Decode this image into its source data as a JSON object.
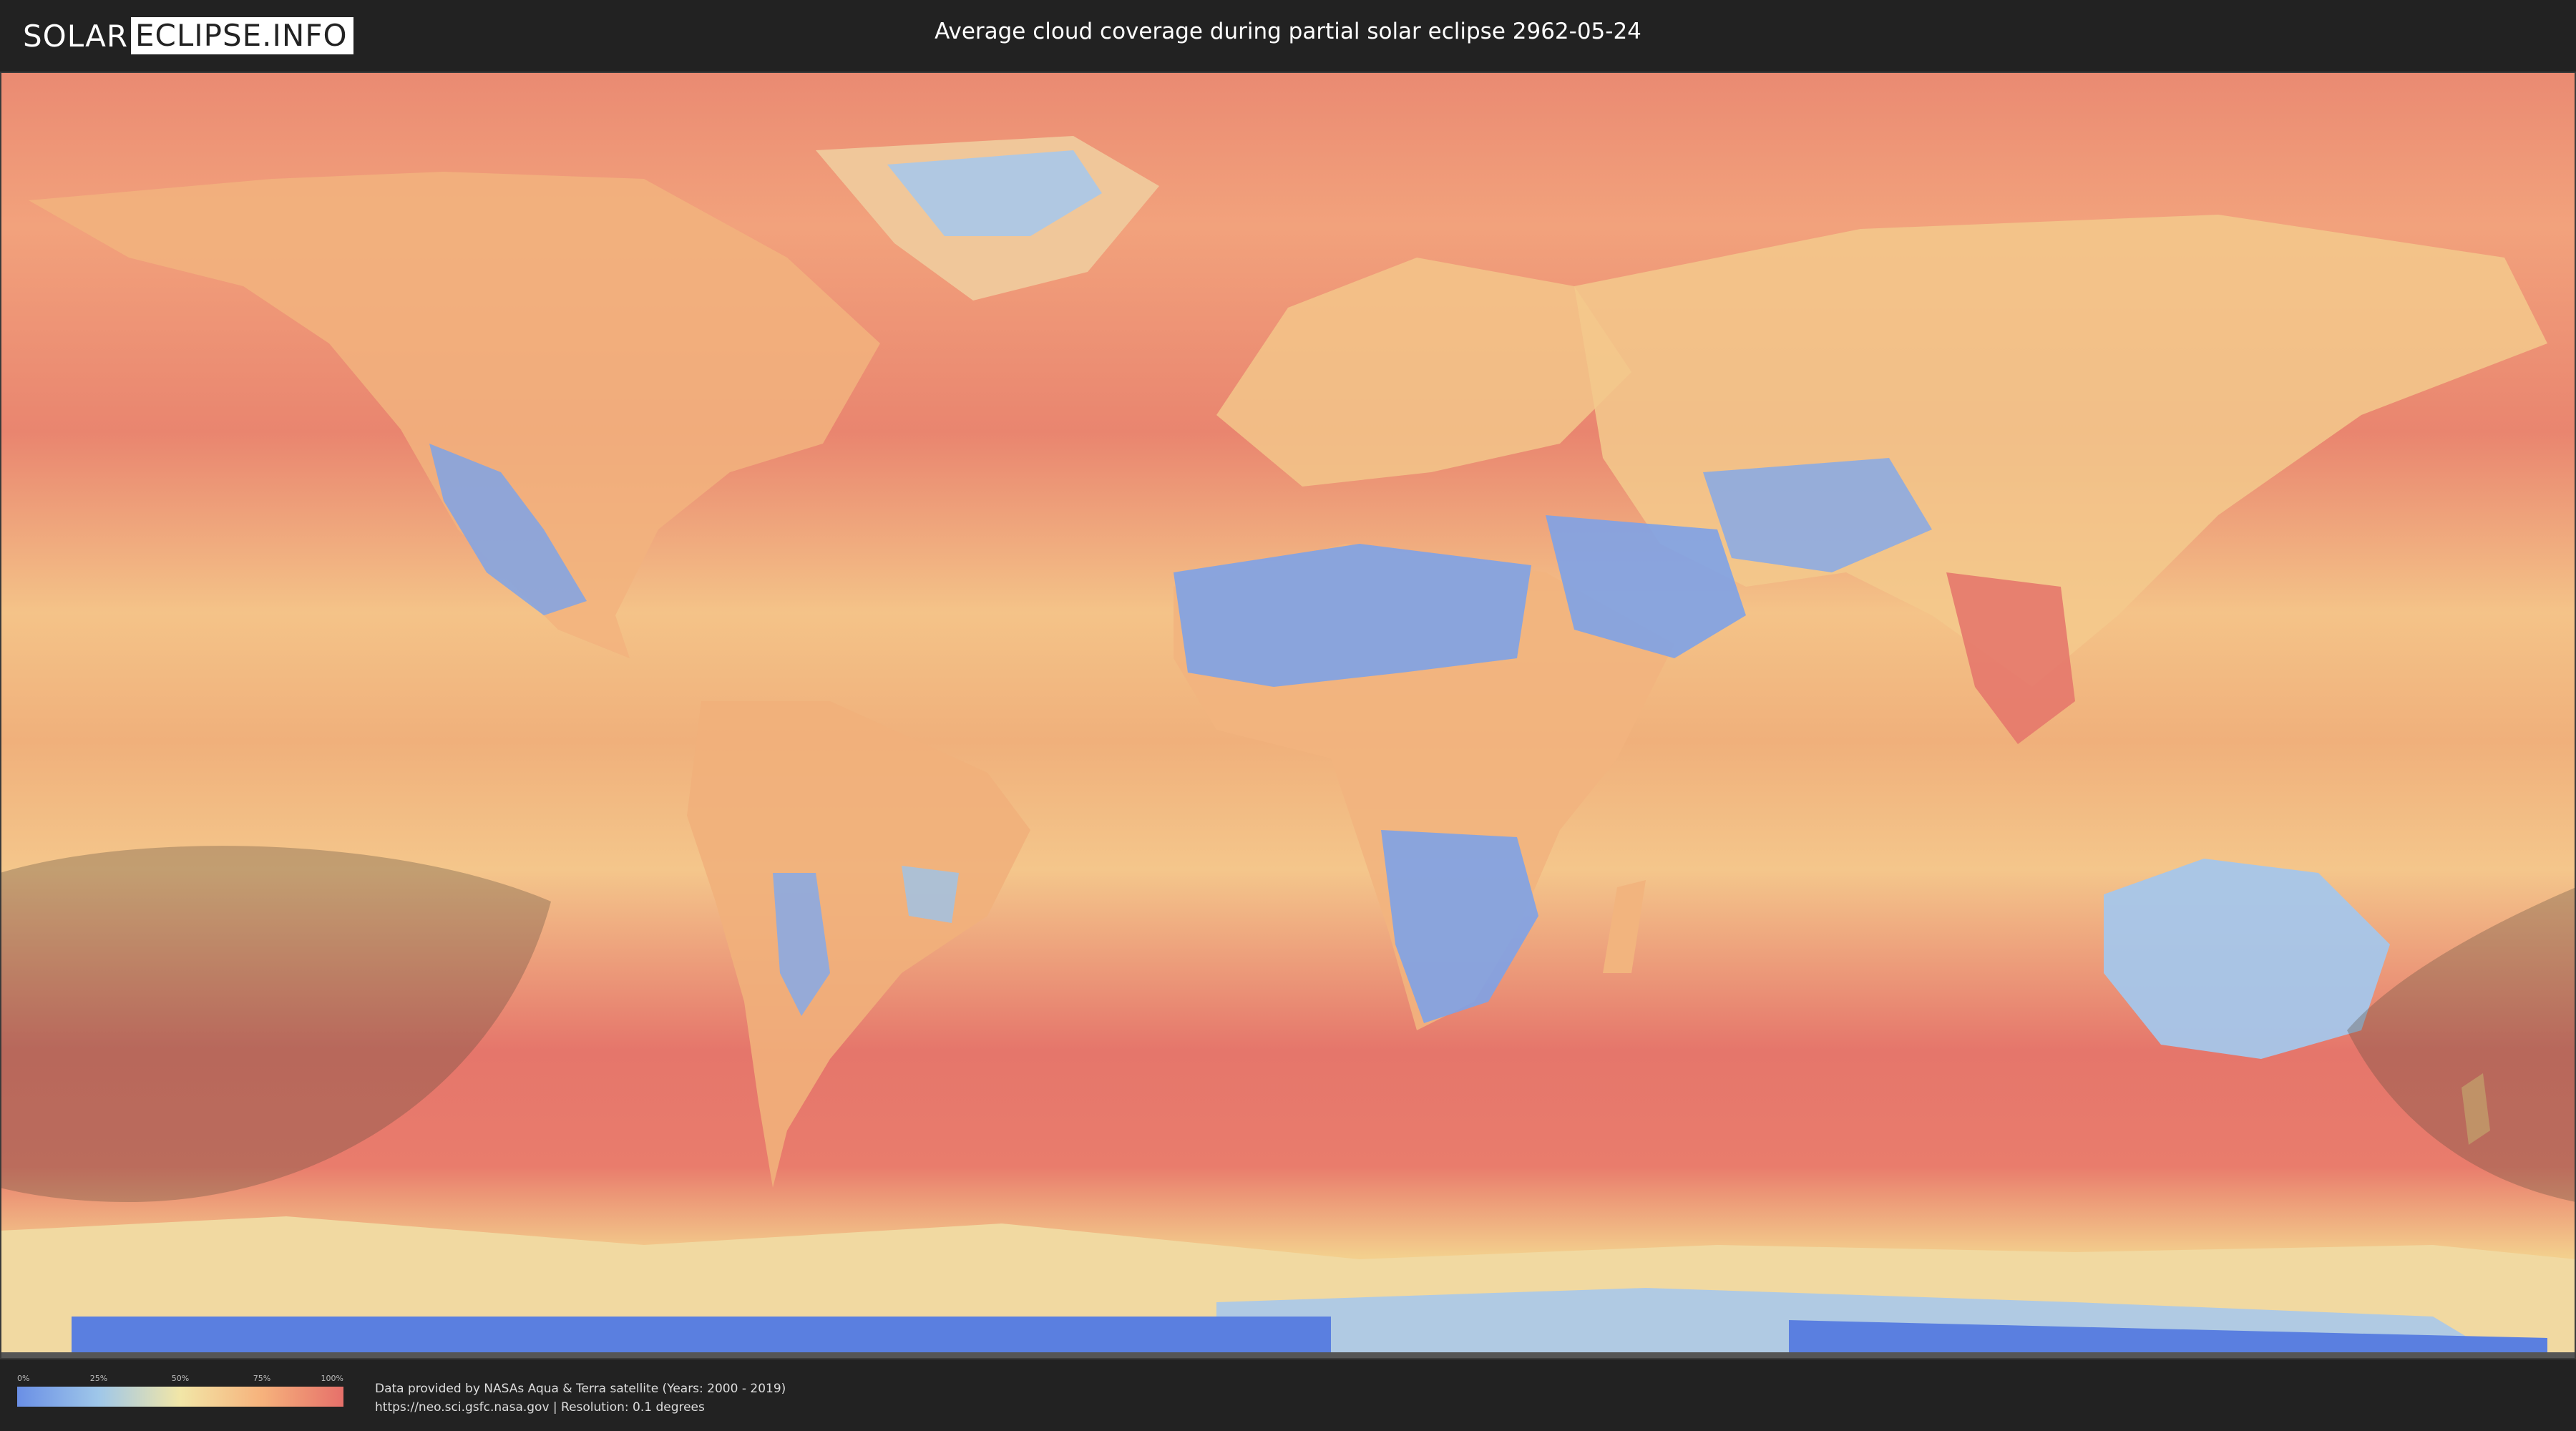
{
  "header": {
    "logo_part1": "SOLAR",
    "logo_part2": "ECLIPSE.INFO",
    "title": "Average cloud coverage during partial solar eclipse 2962-05-24"
  },
  "legend": {
    "ticks": [
      "0%",
      "25%",
      "50%",
      "75%",
      "100%"
    ],
    "colors": [
      "#6a8fe6",
      "#9fc7e9",
      "#f2e6a7",
      "#f6b27c",
      "#e6706a"
    ]
  },
  "credits": {
    "line1": "Data provided by NASAs Aqua & Terra satellite (Years: 2000 - 2019)",
    "line2": "https://neo.sci.gsfc.nasa.gov | Resolution: 0.1 degrees"
  },
  "map": {
    "ocean_color": "#e9836f",
    "low_cloud_color": "#7ca0e8",
    "mid_color": "#f3d18a",
    "eclipse_shadow_color": "#5a4a3a"
  }
}
